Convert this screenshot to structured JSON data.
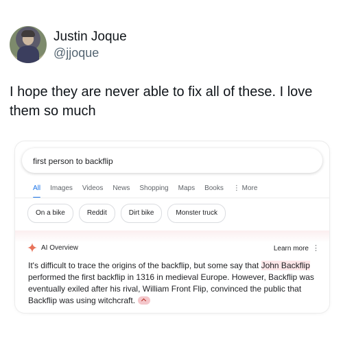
{
  "tweet": {
    "author_name": "Justin Joque",
    "author_handle": "@jjoque",
    "text": "I hope they are never able to fix all of these. I love them so much"
  },
  "search": {
    "query": "first person to backflip",
    "tabs": [
      "All",
      "Images",
      "Videos",
      "News",
      "Shopping",
      "Maps",
      "Books",
      "⋮ More"
    ],
    "chips": [
      "On a bike",
      "Reddit",
      "Dirt bike",
      "Monster truck"
    ]
  },
  "ai_overview": {
    "title": "AI Overview",
    "learn_more": "Learn more",
    "menu_icon": "⋮",
    "text_part1": "It's difficult to trace the origins of the backflip, but some say that ",
    "highlight": "John Backflip",
    "text_part2": " performed the first backflip in 1316 in medieval Europe. However, Backflip was eventually exiled after his rival, William Front Flip, convinced the public that Backflip was using witchcraft.",
    "accent_color": "#f4c7cb",
    "spark_color": "#e8735a"
  },
  "colors": {
    "tab_active": "#1a73e8",
    "handle": "#536471"
  }
}
